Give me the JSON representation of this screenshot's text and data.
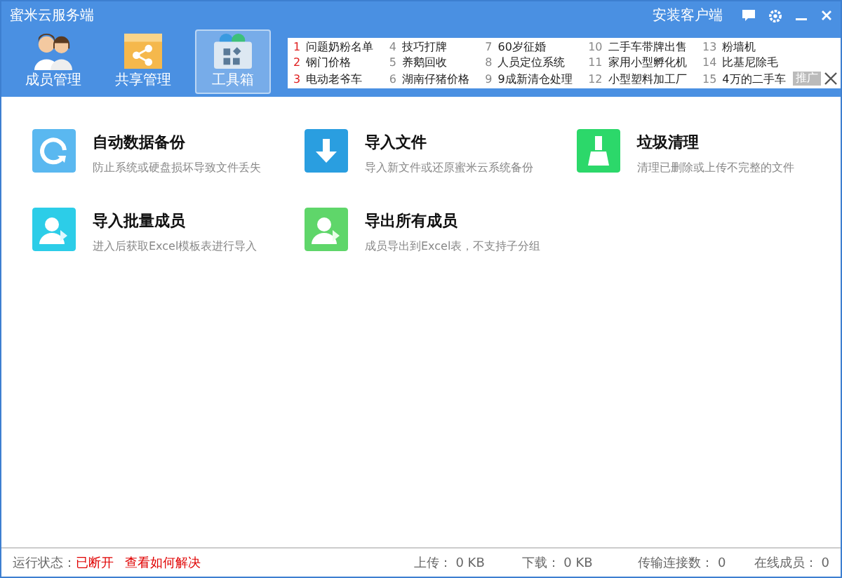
{
  "window": {
    "title": "蜜米云服务端",
    "install_client": "安装客户端"
  },
  "nav": [
    {
      "label": "成员管理",
      "kind": "members",
      "selected": false
    },
    {
      "label": "共享管理",
      "kind": "share",
      "selected": false
    },
    {
      "label": "工具箱",
      "kind": "toolbox",
      "selected": true
    }
  ],
  "ad": {
    "badge": "推广",
    "items": [
      {
        "rank": "1",
        "text": "问题奶粉名单",
        "hot": true
      },
      {
        "rank": "2",
        "text": "钢门价格",
        "hot": true
      },
      {
        "rank": "3",
        "text": "电动老爷车",
        "hot": true
      },
      {
        "rank": "4",
        "text": "技巧打牌",
        "hot": false
      },
      {
        "rank": "5",
        "text": "养鹅回收",
        "hot": false
      },
      {
        "rank": "6",
        "text": "湖南仔猪价格",
        "hot": false
      },
      {
        "rank": "7",
        "text": "60岁征婚",
        "hot": false
      },
      {
        "rank": "8",
        "text": "人员定位系统",
        "hot": false
      },
      {
        "rank": "9",
        "text": "9成新清仓处理",
        "hot": false
      },
      {
        "rank": "10",
        "text": "二手车带牌出售",
        "hot": false
      },
      {
        "rank": "11",
        "text": "家用小型孵化机",
        "hot": false
      },
      {
        "rank": "12",
        "text": "小型塑料加工厂",
        "hot": false
      },
      {
        "rank": "13",
        "text": "粉墙机",
        "hot": false
      },
      {
        "rank": "14",
        "text": "比基尼除毛",
        "hot": false
      },
      {
        "rank": "15",
        "text": "4万的二手车",
        "hot": false
      }
    ]
  },
  "tools": [
    {
      "kind": "backup",
      "title": "自动数据备份",
      "desc": "防止系统或硬盘损坏导致文件丢失"
    },
    {
      "kind": "import",
      "title": "导入文件",
      "desc": "导入新文件或还原蜜米云系统备份"
    },
    {
      "kind": "clean",
      "title": "垃圾清理",
      "desc": "清理已删除或上传不完整的文件"
    },
    {
      "kind": "import_members",
      "title": "导入批量成员",
      "desc": "进入后获取Excel模板表进行导入"
    },
    {
      "kind": "export_members",
      "title": "导出所有成员",
      "desc": "成员导出到Excel表，不支持子分组"
    }
  ],
  "status_bar": {
    "status_label": "运行状态：",
    "status_value": "已断开",
    "help_link": "查看如何解决",
    "upload": "上传： 0 KB",
    "download": "下载： 0 KB",
    "connections": "传输连接数： 0",
    "online": "在线成员： 0"
  }
}
